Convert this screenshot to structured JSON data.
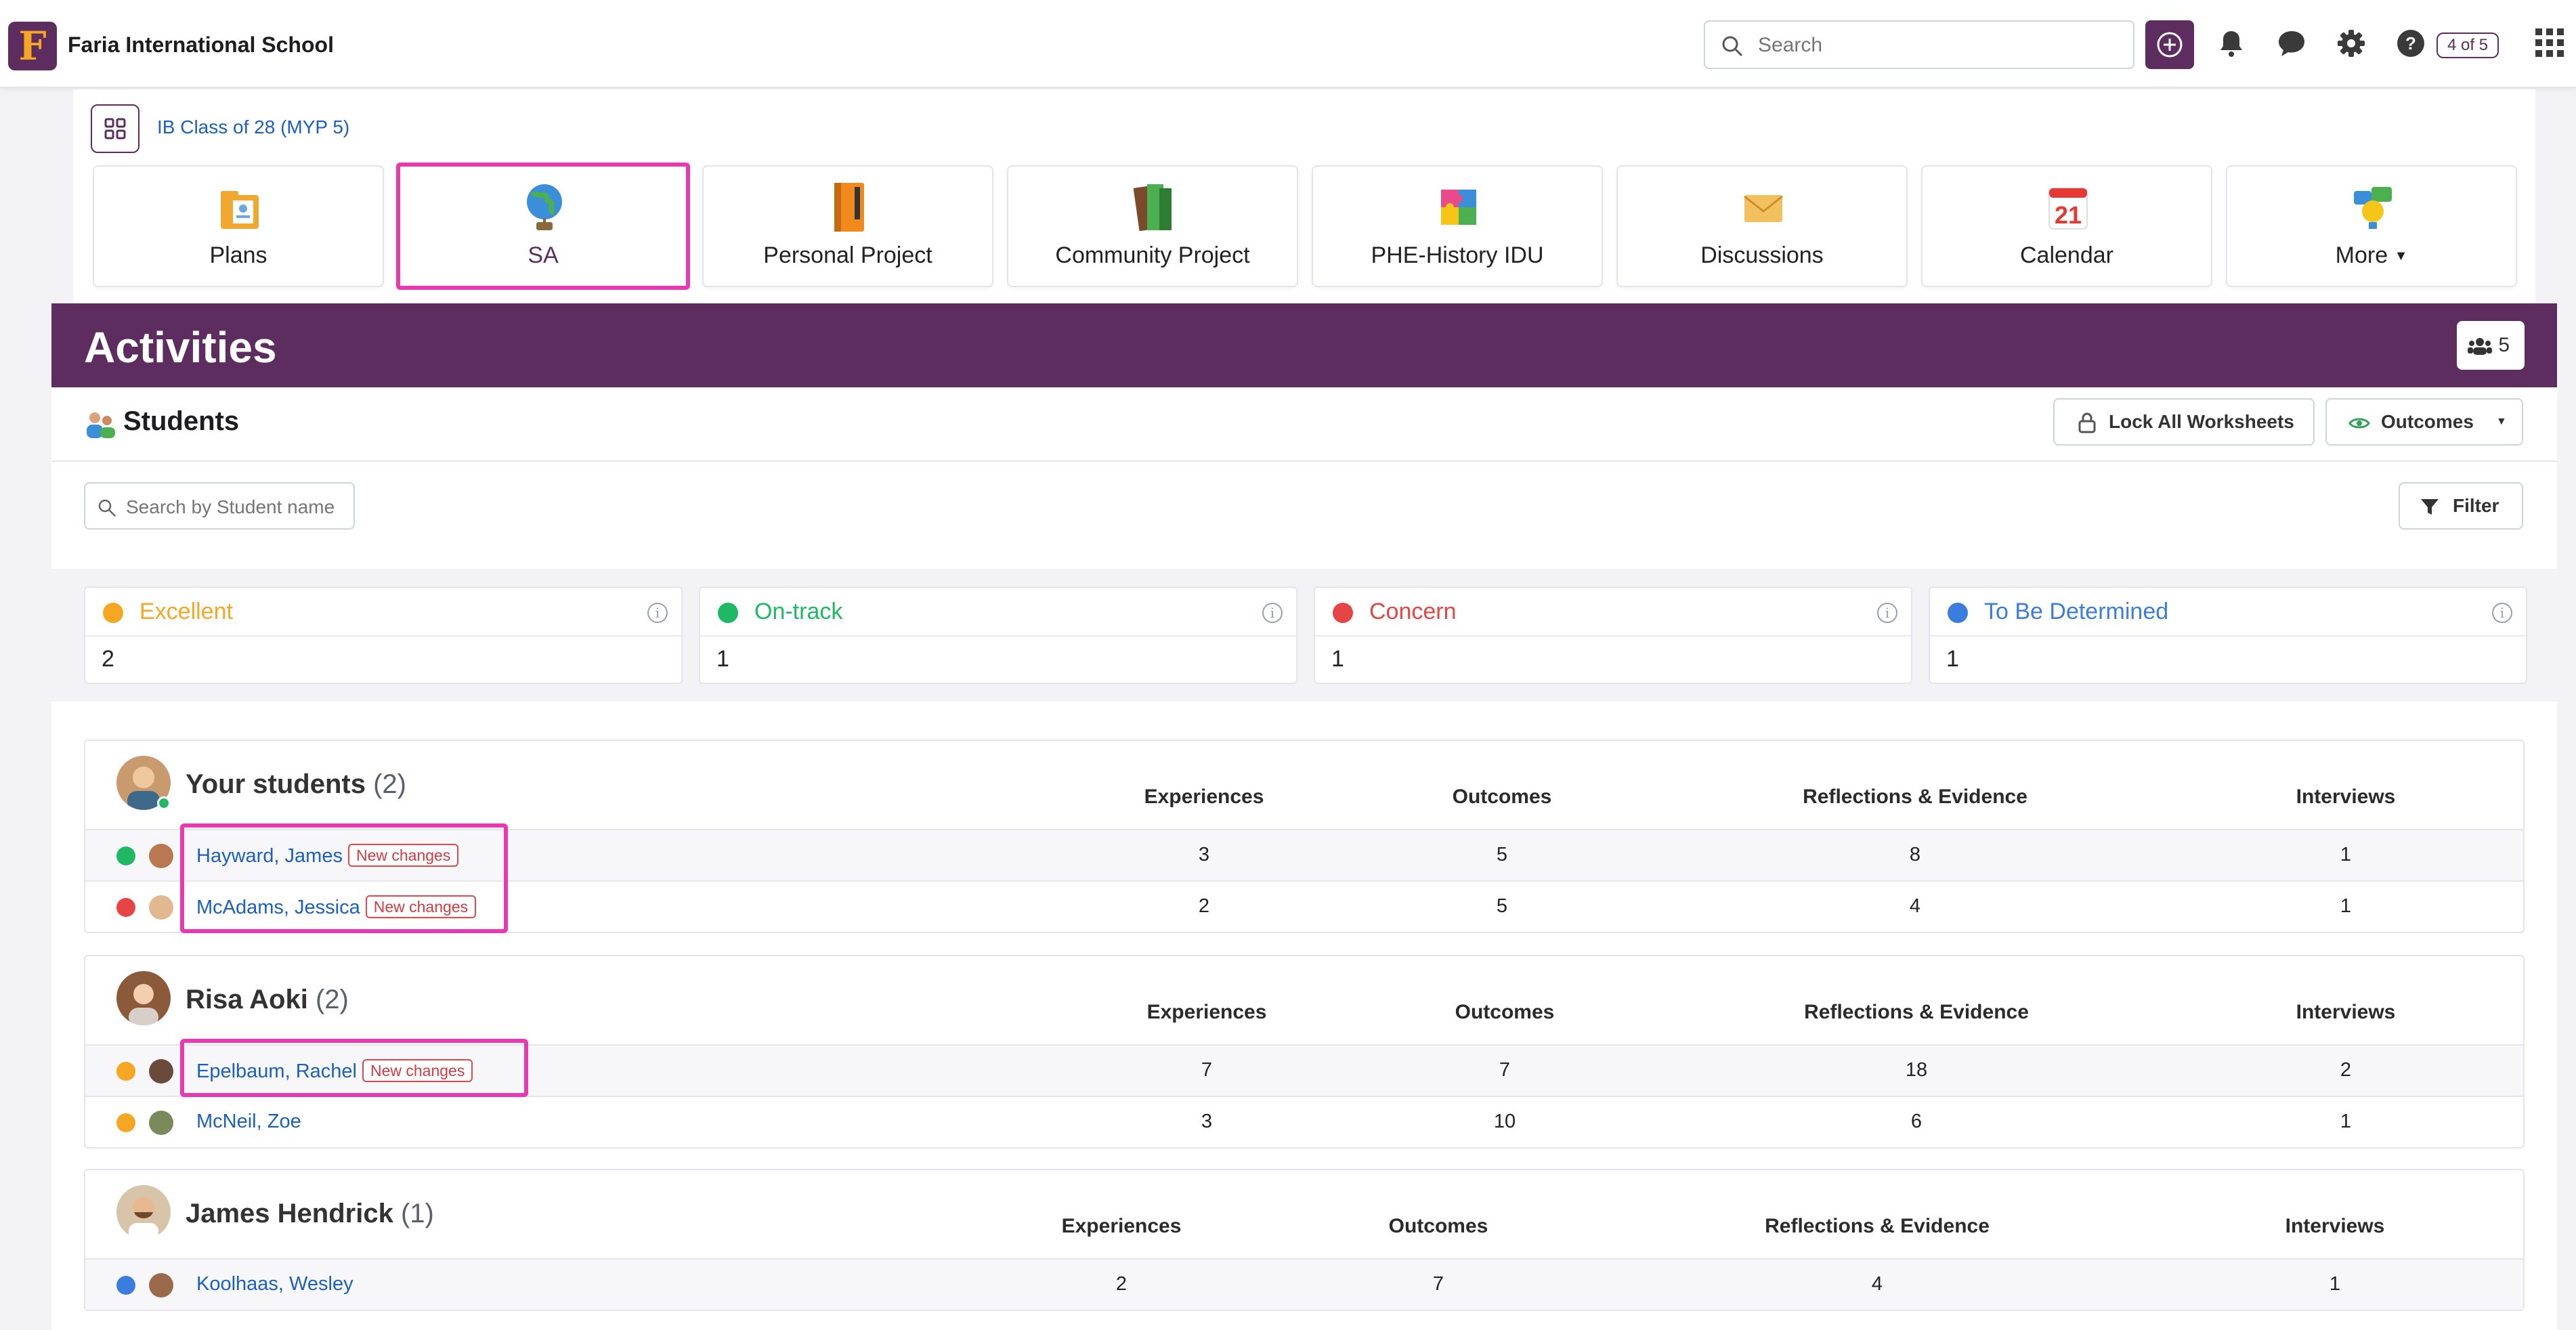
{
  "header": {
    "logo_letter": "F",
    "school_name": "Faria International School",
    "search_placeholder": "Search",
    "pager": "4 of 5"
  },
  "class_nav": {
    "class_link": "IB Class of 28 (MYP 5)",
    "tiles": [
      {
        "label": "Plans",
        "icon": "plans-icon"
      },
      {
        "label": "SA",
        "icon": "globe-icon",
        "selected": true
      },
      {
        "label": "Personal Project",
        "icon": "notebook-icon"
      },
      {
        "label": "Community Project",
        "icon": "books-icon"
      },
      {
        "label": "PHE-History IDU",
        "icon": "puzzle-icon"
      },
      {
        "label": "Discussions",
        "icon": "envelope-icon"
      },
      {
        "label": "Calendar",
        "icon": "calendar-icon",
        "day": "21"
      },
      {
        "label": "More",
        "icon": "lightbulb-icon",
        "dropdown": true
      }
    ]
  },
  "activities": {
    "title": "Activities",
    "member_count": "5"
  },
  "students": {
    "title": "Students",
    "lock_label": "Lock All Worksheets",
    "outcomes_label": "Outcomes",
    "search_placeholder": "Search by Student name",
    "filter_label": "Filter"
  },
  "statuses": [
    {
      "name": "Excellent",
      "value": "2",
      "color": "#f5a623"
    },
    {
      "name": "On-track",
      "value": "1",
      "color": "#1fb864"
    },
    {
      "name": "Concern",
      "value": "1",
      "color": "#e64545"
    },
    {
      "name": "To Be Determined",
      "value": "1",
      "color": "#3b7ddd"
    }
  ],
  "columns": [
    "Experiences",
    "Outcomes",
    "Reflections & Evidence",
    "Interviews"
  ],
  "groups": [
    {
      "advisor": "Your students",
      "count": "(2)",
      "students": [
        {
          "name": "Hayward, James",
          "badge": "New changes",
          "status": "On-track",
          "values": [
            "3",
            "5",
            "8",
            "1"
          ]
        },
        {
          "name": "McAdams, Jessica",
          "badge": "New changes",
          "status": "Concern",
          "values": [
            "2",
            "5",
            "4",
            "1"
          ]
        }
      ]
    },
    {
      "advisor": "Risa Aoki",
      "count": "(2)",
      "students": [
        {
          "name": "Epelbaum, Rachel",
          "badge": "New changes",
          "status": "Excellent",
          "values": [
            "7",
            "7",
            "18",
            "2"
          ]
        },
        {
          "name": "McNeil, Zoe",
          "badge": "",
          "status": "Excellent",
          "values": [
            "3",
            "10",
            "6",
            "1"
          ]
        }
      ]
    },
    {
      "advisor": "James Hendrick",
      "count": "(1)",
      "students": [
        {
          "name": "Koolhaas, Wesley",
          "badge": "",
          "status": "To Be Determined",
          "values": [
            "2",
            "7",
            "4",
            "1"
          ]
        }
      ]
    }
  ]
}
